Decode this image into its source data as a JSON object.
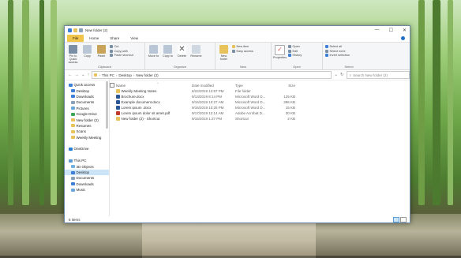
{
  "colors": {
    "accent": "#1e6fc7",
    "file_tab": "#f0c54a",
    "selection": "#cce4f7"
  },
  "window": {
    "title": "New folder (2)",
    "quick_access_toolbar": [
      "save-icon",
      "folder-icon",
      "checkmark-icon"
    ],
    "controls": [
      "—",
      "☐",
      "✕"
    ]
  },
  "ribbon": {
    "tabs": [
      "File",
      "Home",
      "Share",
      "View"
    ],
    "clipboard": {
      "name": "Clipboard",
      "pin": "Pin to Quick access",
      "copy": "Copy",
      "paste": "Paste",
      "cut": "Cut",
      "copy_path": "Copy path",
      "paste_shortcut": "Paste shortcut"
    },
    "organize": {
      "name": "Organize",
      "move_to": "Move to",
      "copy_to": "Copy to",
      "delete": "Delete",
      "rename": "Rename"
    },
    "new": {
      "name": "New",
      "new_folder": "New folder",
      "new_item": "New item",
      "easy_access": "Easy access"
    },
    "open": {
      "name": "Open",
      "properties": "Properties",
      "open": "Open",
      "edit": "Edit",
      "history": "History"
    },
    "select": {
      "name": "Select",
      "select_all": "Select all",
      "select_none": "Select none",
      "invert": "Invert selection"
    }
  },
  "address": {
    "crumbs": [
      "This PC",
      "Desktop",
      "New folder (2)"
    ],
    "search_placeholder": "Search New folder (2)"
  },
  "nav_pane": [
    {
      "label": "Quick access",
      "icon": "star-icon",
      "color": "#3d7fd6",
      "sub": false
    },
    {
      "label": "Desktop",
      "icon": "desktop-icon",
      "color": "#3d7fd6",
      "sub": true
    },
    {
      "label": "Downloads",
      "icon": "download-icon",
      "color": "#3d7fd6",
      "sub": true
    },
    {
      "label": "Documents",
      "icon": "documents-icon",
      "color": "#8aa0b8",
      "sub": true
    },
    {
      "label": "Pictures",
      "icon": "pictures-icon",
      "color": "#6aa6d8",
      "sub": true
    },
    {
      "label": "Google Drive",
      "icon": "google-drive-icon",
      "color": "#3ba55c",
      "sub": true
    },
    {
      "label": "New folder (2)",
      "icon": "folder-icon",
      "color": "#e8c25a",
      "sub": true
    },
    {
      "label": "Resumes",
      "icon": "folder-icon",
      "color": "#e8c25a",
      "sub": true
    },
    {
      "label": "Scans",
      "icon": "folder-icon",
      "color": "#e8c25a",
      "sub": true
    },
    {
      "label": "Weekly Meeting",
      "icon": "folder-icon",
      "color": "#e8c25a",
      "sub": true
    },
    {
      "label": "",
      "icon": "",
      "color": "",
      "sub": false
    },
    {
      "label": "OneDrive",
      "icon": "cloud-icon",
      "color": "#2b7cd3",
      "sub": false
    },
    {
      "label": "",
      "icon": "",
      "color": "",
      "sub": false
    },
    {
      "label": "This PC",
      "icon": "pc-icon",
      "color": "#5b9bd5",
      "sub": false
    },
    {
      "label": "3D Objects",
      "icon": "cube-icon",
      "color": "#6fb1e0",
      "sub": true
    },
    {
      "label": "Desktop",
      "icon": "desktop-icon",
      "color": "#3d7fd6",
      "sub": true,
      "selected": true
    },
    {
      "label": "Documents",
      "icon": "documents-icon",
      "color": "#8aa0b8",
      "sub": true
    },
    {
      "label": "Downloads",
      "icon": "download-icon",
      "color": "#3d7fd6",
      "sub": true
    },
    {
      "label": "Music",
      "icon": "music-icon",
      "color": "#6aa6d8",
      "sub": true
    }
  ],
  "columns": [
    "Name",
    "Date modified",
    "Type",
    "Size"
  ],
  "files": [
    {
      "name": "Weekly Meeting Notes",
      "date": "6/22/2019 12:57 PM",
      "type": "File folder",
      "size": "",
      "icon": "folder-icon",
      "color": "#e8c25a"
    },
    {
      "name": "Brochure.docx",
      "date": "9/13/2019 8:14 PM",
      "type": "Microsoft Word D...",
      "size": "125 KB",
      "icon": "word-doc-icon",
      "color": "#2b5797"
    },
    {
      "name": "Example document.docx",
      "date": "9/16/2019 10:27 AM",
      "type": "Microsoft Word D...",
      "size": "396 KB",
      "icon": "word-doc-icon",
      "color": "#2b5797"
    },
    {
      "name": "Lorem ipsum .docx",
      "date": "9/16/2019 10:25 PM",
      "type": "Microsoft Word D...",
      "size": "15 KB",
      "icon": "word-doc-icon",
      "color": "#2b5797"
    },
    {
      "name": "Lorem ipsum dolor sit amet.pdf",
      "date": "9/17/2019 12:14 AM",
      "type": "Adobe Acrobat D...",
      "size": "30 KB",
      "icon": "pdf-icon",
      "color": "#c0392b"
    },
    {
      "name": "New folder (2) - Shortcut",
      "date": "9/15/2019 1:27 PM",
      "type": "Shortcut",
      "size": "2 KB",
      "icon": "shortcut-icon",
      "color": "#e8c25a"
    }
  ],
  "status": {
    "items": "6 items"
  }
}
